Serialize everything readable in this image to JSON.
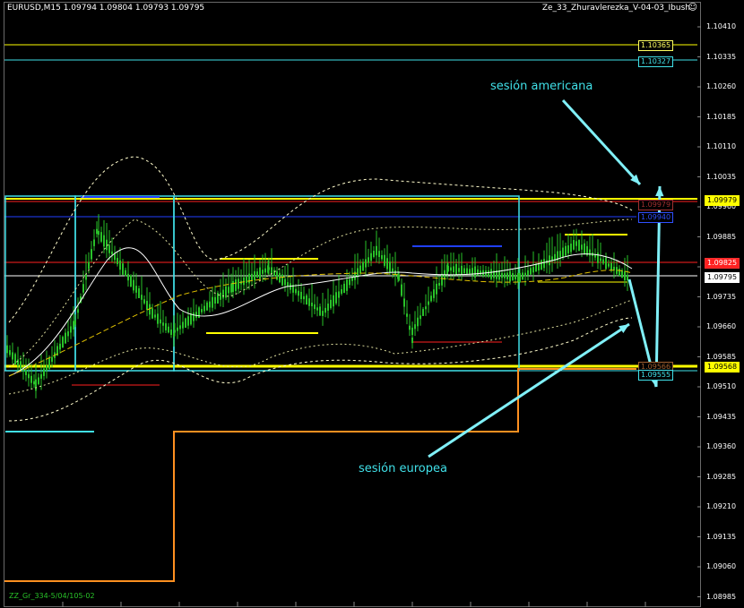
{
  "header": {
    "symbol_info": "EURUSD,M15  1.09794 1.09804 1.09793 1.09795",
    "indicator_name": "Ze_33_Zhuravlerezka_V-04-03_Ibush",
    "smiley_icon": "smiley-icon"
  },
  "annotations": {
    "american_session": "sesión americana",
    "european_session": "sesión europea"
  },
  "price_axis": [
    "1.10410",
    "1.10335",
    "1.10260",
    "1.10185",
    "1.10110",
    "1.10035",
    "1.09960",
    "1.09885",
    "1.09810",
    "1.09735",
    "1.09660",
    "1.09585",
    "1.09510",
    "1.09435",
    "1.09360",
    "1.09285",
    "1.09210",
    "1.09135",
    "1.09060",
    "1.08985"
  ],
  "level_tags": [
    {
      "text": "1.10365",
      "color": "#ffff60",
      "border": "#ffff60",
      "bg": "#000000"
    },
    {
      "text": "1.10327",
      "color": "#40e0e8",
      "border": "#40e0e8",
      "bg": "#000000"
    },
    {
      "text": "1.09979",
      "color": "#000000",
      "border": "#ffff00",
      "bg": "#ffff00"
    },
    {
      "text": "1.09568",
      "color": "#000000",
      "border": "#ffff00",
      "bg": "#ffff00"
    },
    {
      "text": "1.09795",
      "color": "#000000",
      "border": "#ffffff",
      "bg": "#ffffff"
    },
    {
      "text": "1.09825",
      "color": "#ffffff",
      "border": "#ff3030",
      "bg": "#ff2020"
    }
  ],
  "overlay_tags": [
    {
      "text": "1.09979",
      "color": "#a03030"
    },
    {
      "text": "1.09940",
      "color": "#3050ff"
    },
    {
      "text": "1.09566",
      "color": "#a06030"
    },
    {
      "text": "1.09555",
      "color": "#40e0e8"
    }
  ],
  "footer": "ZZ_Gr_334-5/04/105-02",
  "colors": {
    "candle": "#29c229",
    "yellow_line": "#ffff00",
    "cyan_line": "#40e0e8",
    "blue_line": "#2040ff",
    "red_line": "#ff2020",
    "orange_step": "#ff9020",
    "arrow": "#80f0f8"
  }
}
